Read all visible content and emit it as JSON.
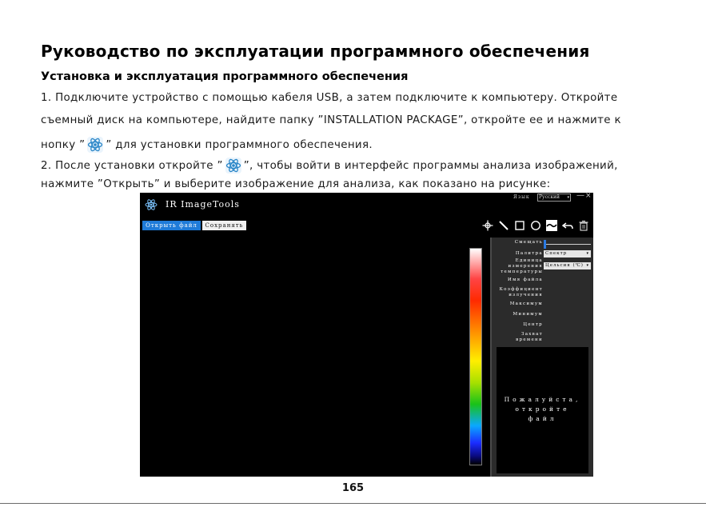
{
  "document": {
    "title": "Руководство по эксплуатации программного обеспечения",
    "subtitle": "Установка и эксплуатация программного обеспечения",
    "step1_line1": "1. Подключите устройство с помощью кабеля USB, а затем подключите к компьютеру. Откройте",
    "step1_line2": "съемный диск на компьютере, найдите папку ”INSTALLATION PACKAGE”, откройте ее и нажмите к",
    "step1_line3_pre": "нопку ”",
    "step1_line3_post": "” для установки программного обеспечения.",
    "step2_line1_pre": "2. После установки откройте ”",
    "step2_line1_post": "”, чтобы войти в интерфейс программы анализа изображений,",
    "step2_line2": "нажмите ”Открыть” и выберите изображение для анализа, как показано на рисунке:",
    "page_number": "165"
  },
  "app": {
    "title": "IR ImageTools",
    "language_label": "Язык",
    "language_value": "Русский",
    "minimize_glyph": "—",
    "close_glyph": "×",
    "open_file_button": "Открыть файл",
    "save_button": "Сохранять",
    "panel": {
      "zoom_label": "Смещать",
      "zoom_value": 0,
      "palette_label": "Палитра",
      "palette_value": "Спектр",
      "unit_label_1": "Единица",
      "unit_label_2": "измерения",
      "unit_label_3": "температуры",
      "unit_value": "Цельсия (℃)",
      "file_name_label": "Имя файла",
      "emissivity_label_1": "Коэффициент",
      "emissivity_label_2": "излучения",
      "max_label": "Максимум",
      "min_label": "Минимум",
      "center_label": "Центр",
      "time_label_1": "Захват",
      "time_label_2": "времени",
      "preview_line1": "Пожалуйста,",
      "preview_line2": "откройте",
      "preview_line3": "файл"
    },
    "tools": [
      "crosshair-icon",
      "line-icon",
      "rectangle-icon",
      "circle-icon",
      "curve-icon",
      "undo-icon",
      "trash-icon"
    ],
    "colors": {
      "accent": "#1f7bd8",
      "panel_bg": "#2b2b2b",
      "slider_knob": "#2a7ae2"
    }
  }
}
